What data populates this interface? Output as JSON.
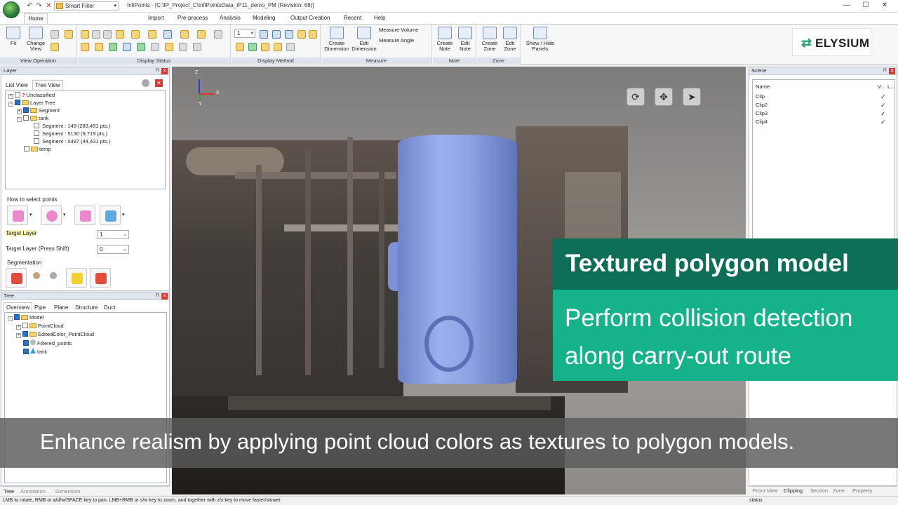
{
  "app": {
    "window_title": "InfiPoints - [C:\\IP_Project_C\\InfiPointsData_IP11_demo_PM (Revision: 68)]",
    "smart_filter": "Smart Filter"
  },
  "menu": {
    "tabs": [
      "Home",
      "Import",
      "Pre-process",
      "Analysis",
      "Modeling",
      "Output Creation",
      "Recent",
      "Help"
    ]
  },
  "ribbon": {
    "fit": "Fit",
    "change_view": "Change View",
    "groups": {
      "view_operation": "View Operation",
      "display_status": "Display Status",
      "display_method": "Display Method",
      "measure": "Measure",
      "note": "Note",
      "zone": "Zone"
    },
    "create_dimension": "Create Dimension",
    "edit_dimension": "Edit Dimension",
    "measure_volume": "Measure Volume",
    "measure_angle": "Measure Angle",
    "create_note": "Create Note",
    "edit_note": "Edit Note",
    "create_zone": "Create Zone",
    "edit_zone": "Edit Zone",
    "show_hide_panels": "Show / Hide Panels",
    "display_method_value": "1"
  },
  "logo": {
    "text": "ELYSIUM"
  },
  "layer_panel": {
    "title": "Layer",
    "tabs": [
      "List View",
      "Tree View"
    ],
    "tree": [
      "Unclassified",
      "Layer Tree",
      "Segment",
      "tank",
      "Segment : 149 (283,491 pts.)",
      "Segment : 5130 (9,719 pts.)",
      "Segment : 5487 (44,431 pts.)",
      "temp"
    ],
    "how_to_select": "How to select points",
    "target_layer_label": "Target Layer",
    "target_layer_value": "1",
    "target_layer_shift_label": "Target Layer (Press Shift)",
    "target_layer_shift_value": "0",
    "segmentation": "Segmentation"
  },
  "tree_panel": {
    "title": "Tree",
    "tabs": [
      "Overview",
      "Pipe",
      "Plane",
      "Structure",
      "Duct"
    ],
    "items": [
      "Model",
      "PointCloud",
      "EditedColor_PointCloud",
      "Filtered_points",
      "tank"
    ]
  },
  "scene_panel": {
    "title": "Scene",
    "columns": [
      "Name",
      "V..",
      "L.."
    ],
    "rows": [
      {
        "name": "Clip",
        "check": "✓"
      },
      {
        "name": "Clip2",
        "check": "✓"
      },
      {
        "name": "Clip3",
        "check": "✓"
      },
      {
        "name": "Clip4",
        "check": "✓"
      }
    ],
    "bottom_tabs": [
      "Front View",
      "Clipping",
      "Section",
      "Zone",
      "Property"
    ]
  },
  "left_bottom_tabs": [
    "Tree",
    "Annotation",
    "Dimension"
  ],
  "viewport": {
    "axis_z": "Z",
    "axis_x": "X",
    "axis_y": "Y"
  },
  "overlay": {
    "title": "Textured polygon model",
    "body_line1": "Perform collision detection",
    "body_line2": "along carry-out route",
    "caption": "Enhance realism by applying point cloud colors as textures to polygon models."
  },
  "statusbar": {
    "hint": "LMB to rotate, RMB or a/d/w/SPACE key to pan, LMB+RMB or s/w key to zoom, and together with z/x key to move faster/slower.",
    "status": "status"
  }
}
